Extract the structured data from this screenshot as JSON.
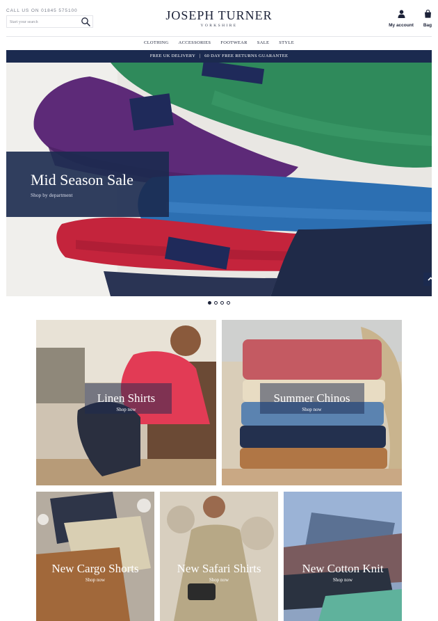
{
  "header": {
    "phone": "CALL US ON 01845 575100",
    "search_placeholder": "Start your search",
    "logo_main": "JOSEPH TURNER",
    "logo_sub": "YORKSHIRE",
    "account_label": "My account",
    "bag_label": "Bag"
  },
  "nav": {
    "items": [
      {
        "label": "CLOTHING"
      },
      {
        "label": "ACCESSORIES"
      },
      {
        "label": "FOOTWEAR"
      },
      {
        "label": "SALE"
      },
      {
        "label": "STYLE"
      }
    ]
  },
  "promo": {
    "text": "FREE UK DELIVERY   |   60 DAY FREE RETURNS GUARANTEE"
  },
  "hero": {
    "title": "Mid Season Sale",
    "subtitle": "Shop by department",
    "active_slide": 1,
    "slide_count": 4
  },
  "tiles": [
    {
      "title": "Linen Shirts",
      "link": "Shop now"
    },
    {
      "title": "Summer Chinos",
      "link": "Shop now"
    },
    {
      "title": "New Cargo Shorts",
      "link": "Shop now"
    },
    {
      "title": "New Safari Shirts",
      "link": "Shop now"
    },
    {
      "title": "New Cotton Knit",
      "link": "Shop now"
    }
  ],
  "icons": {
    "search": "search-icon",
    "account": "user-icon",
    "bag": "shopping-bag-icon",
    "scroll_top": "chevron-up-icon"
  },
  "colors": {
    "brand_navy": "#1b2a4f",
    "text": "#1c2238",
    "background": "#ffffff"
  }
}
